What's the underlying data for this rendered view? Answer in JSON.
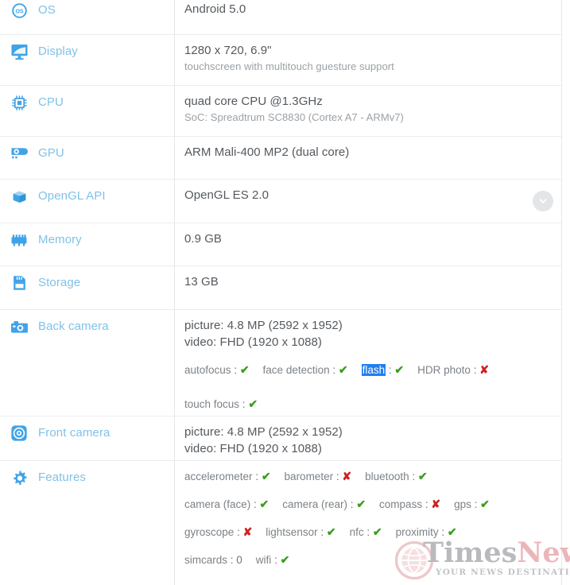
{
  "rows": [
    {
      "key": "os",
      "icon": "os-icon",
      "label": "OS",
      "value": "Android 5.0",
      "sub": ""
    },
    {
      "key": "display",
      "icon": "display-monitor-icon",
      "label": "Display",
      "value": "1280 x 720, 6.9\"",
      "sub": "touchscreen with multitouch guesture support"
    },
    {
      "key": "cpu",
      "icon": "cpu-chip-icon",
      "label": "CPU",
      "value": "quad core CPU @1.3GHz",
      "sub": "SoC: Spreadtrum SC8830 (Cortex A7 - ARMv7)"
    },
    {
      "key": "gpu",
      "icon": "gpu-card-icon",
      "label": "GPU",
      "value": "ARM Mali-400 MP2 (dual core)",
      "sub": ""
    },
    {
      "key": "opengl",
      "icon": "cube-icon",
      "label": "OpenGL API",
      "value": "OpenGL ES 2.0",
      "sub": ""
    },
    {
      "key": "memory",
      "icon": "memory-ram-icon",
      "label": "Memory",
      "value": "0.9 GB",
      "sub": ""
    },
    {
      "key": "storage",
      "icon": "storage-card-icon",
      "label": "Storage",
      "value": "13 GB",
      "sub": ""
    },
    {
      "key": "back_camera",
      "icon": "camera-icon",
      "label": "Back camera",
      "value": "picture: 4.8 MP (2592 x 1952)",
      "sub": "video: FHD (1920 x 1088)"
    },
    {
      "key": "front_camera",
      "icon": "front-camera-lens-icon",
      "label": "Front camera",
      "value": "picture: 4.8 MP (2592 x 1952)",
      "sub": "video: FHD (1920 x 1088)"
    },
    {
      "key": "features",
      "icon": "gear-icon",
      "label": "Features",
      "value": "",
      "sub": ""
    }
  ],
  "back_camera_flags": {
    "line1": [
      {
        "name": "autofocus",
        "sep": ":",
        "state": "yes",
        "selected": false
      },
      {
        "name": "face detection",
        "sep": ":",
        "state": "yes",
        "selected": false
      },
      {
        "name": "flash",
        "sep": ":",
        "state": "yes",
        "selected": true
      },
      {
        "name": "HDR photo",
        "sep": ":",
        "state": "no",
        "selected": false
      }
    ],
    "line2": [
      {
        "name": "touch focus",
        "sep": ":",
        "state": "yes",
        "selected": false
      }
    ]
  },
  "features_flags": {
    "line1": [
      {
        "name": "accelerometer",
        "sep": ":",
        "state": "yes"
      },
      {
        "name": "barometer",
        "sep": ":",
        "state": "no"
      },
      {
        "name": "bluetooth",
        "sep": ":",
        "state": "yes"
      }
    ],
    "line2": [
      {
        "name": "camera (face)",
        "sep": ":",
        "state": "yes"
      },
      {
        "name": "camera (rear)",
        "sep": ":",
        "state": "yes"
      },
      {
        "name": "compass",
        "sep": ":",
        "state": "no"
      },
      {
        "name": "gps",
        "sep": ":",
        "state": "yes"
      }
    ],
    "line3": [
      {
        "name": "gyroscope",
        "sep": ":",
        "state": "no"
      },
      {
        "name": "lightsensor",
        "sep": ":",
        "state": "yes"
      },
      {
        "name": "nfc",
        "sep": ":",
        "state": "yes"
      },
      {
        "name": "proximity",
        "sep": ":",
        "state": "yes"
      }
    ],
    "line4": [
      {
        "name": "simcards",
        "sep": ":",
        "state": "text",
        "text": "0"
      },
      {
        "name": "wifi",
        "sep": ":",
        "state": "yes"
      }
    ]
  },
  "marks": {
    "yes": "✔",
    "no": "✘"
  },
  "collapse": {
    "icon": "chevron-down-icon",
    "row": "opengl"
  },
  "watermark": {
    "title_part1": "Times",
    "title_part2": "News",
    "tagline": "YOUR NEWS DESTINATION",
    "logo": "globe-icon"
  },
  "colors": {
    "label": "#7fc2e8",
    "value": "#54595e",
    "sub": "#9ba1a6",
    "yes": "#3a9e1e",
    "no": "#cc2222",
    "selection": "#1f7ff0",
    "icon": "#3fa3e8",
    "divider": "#e9ecef"
  }
}
